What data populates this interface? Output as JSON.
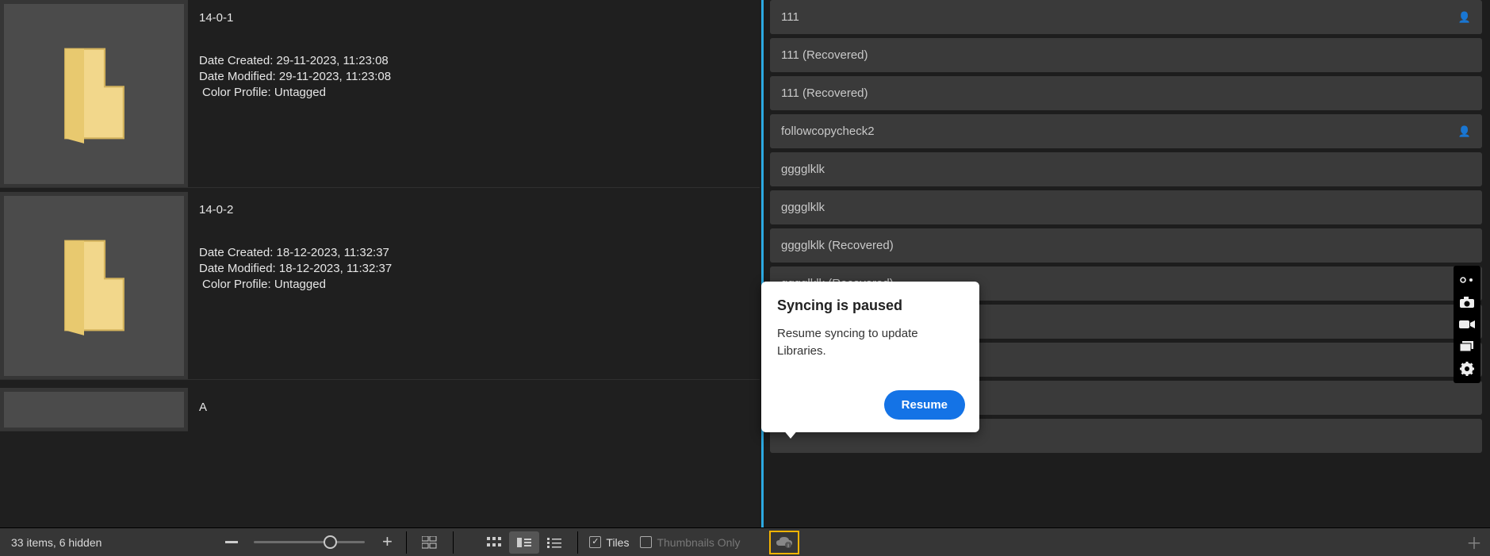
{
  "files": [
    {
      "name": "14-0-1",
      "date_created_label": "Date Created: 29-11-2023, 11:23:08",
      "date_modified_label": "Date Modified: 29-11-2023, 11:23:08",
      "color_profile_label": "Color Profile: Untagged"
    },
    {
      "name": "14-0-2",
      "date_created_label": "Date Created: 18-12-2023, 11:32:37",
      "date_modified_label": "Date Modified: 18-12-2023, 11:32:37",
      "color_profile_label": "Color Profile: Untagged"
    },
    {
      "name": "A"
    }
  ],
  "libraries": [
    {
      "name": "111",
      "shared": true
    },
    {
      "name": "111 (Recovered)",
      "shared": false
    },
    {
      "name": "111 (Recovered)",
      "shared": false
    },
    {
      "name": "followcopycheck2",
      "shared": true
    },
    {
      "name": "gggglklk",
      "shared": false
    },
    {
      "name": "gggglklk",
      "shared": false
    },
    {
      "name": "gggglklk (Recovered)",
      "shared": false
    },
    {
      "name": "gggglklk (Recovered)",
      "shared": false
    }
  ],
  "popup": {
    "title": "Syncing is paused",
    "message": "Resume syncing to update Libraries.",
    "button": "Resume"
  },
  "bottombar": {
    "status": "33 items, 6 hidden",
    "tiles_label": "Tiles",
    "thumbnails_label": "Thumbnails Only"
  }
}
